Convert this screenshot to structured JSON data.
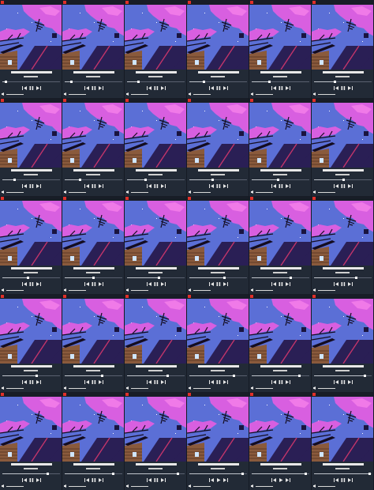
{
  "app": {
    "player_count": 30
  },
  "theme": {
    "background": "#1c2330",
    "player_panel": "#222a36",
    "close_button": "#e0302a",
    "sky": "#5b6fd6",
    "clouds": "#d85fe0",
    "cloud_highlight": "#f07ae8",
    "roof": "#2a1f55",
    "house_wall": "#8a5a3c",
    "window_light": "#cfe6ff"
  },
  "icons": {
    "close": "close-icon",
    "previous": "skip-previous-icon",
    "play": "play-icon",
    "pause": "pause-icon",
    "next": "skip-next-icon",
    "volume": "volume-icon"
  },
  "players": [
    {
      "progress": 0.04,
      "state": "playing"
    },
    {
      "progress": 0.1,
      "state": "playing"
    },
    {
      "progress": 0.18,
      "state": "playing"
    },
    {
      "progress": 0.24,
      "state": "playing"
    },
    {
      "progress": 0.3,
      "state": "playing"
    },
    {
      "progress": 0.36,
      "state": "playing"
    },
    {
      "progress": 0.2,
      "state": "playing"
    },
    {
      "progress": 0.26,
      "state": "playing"
    },
    {
      "progress": 0.32,
      "state": "playing"
    },
    {
      "progress": 0.4,
      "state": "playing"
    },
    {
      "progress": 0.46,
      "state": "playing"
    },
    {
      "progress": 0.52,
      "state": "playing"
    },
    {
      "progress": 0.44,
      "state": "playing"
    },
    {
      "progress": 0.5,
      "state": "playing"
    },
    {
      "progress": 0.56,
      "state": "playing"
    },
    {
      "progress": 0.62,
      "state": "playing"
    },
    {
      "progress": 0.68,
      "state": "playing"
    },
    {
      "progress": 0.74,
      "state": "playing"
    },
    {
      "progress": 0.6,
      "state": "playing"
    },
    {
      "progress": 0.66,
      "state": "playing"
    },
    {
      "progress": 0.72,
      "state": "playing"
    },
    {
      "progress": 0.78,
      "state": "playing"
    },
    {
      "progress": 0.84,
      "state": "playing"
    },
    {
      "progress": 0.9,
      "state": "playing"
    },
    {
      "progress": 0.8,
      "state": "playing"
    },
    {
      "progress": 0.86,
      "state": "playing"
    },
    {
      "progress": 0.9,
      "state": "playing"
    },
    {
      "progress": 0.94,
      "state": "paused"
    },
    {
      "progress": 0.96,
      "state": "paused"
    },
    {
      "progress": 0.98,
      "state": "playing"
    }
  ]
}
